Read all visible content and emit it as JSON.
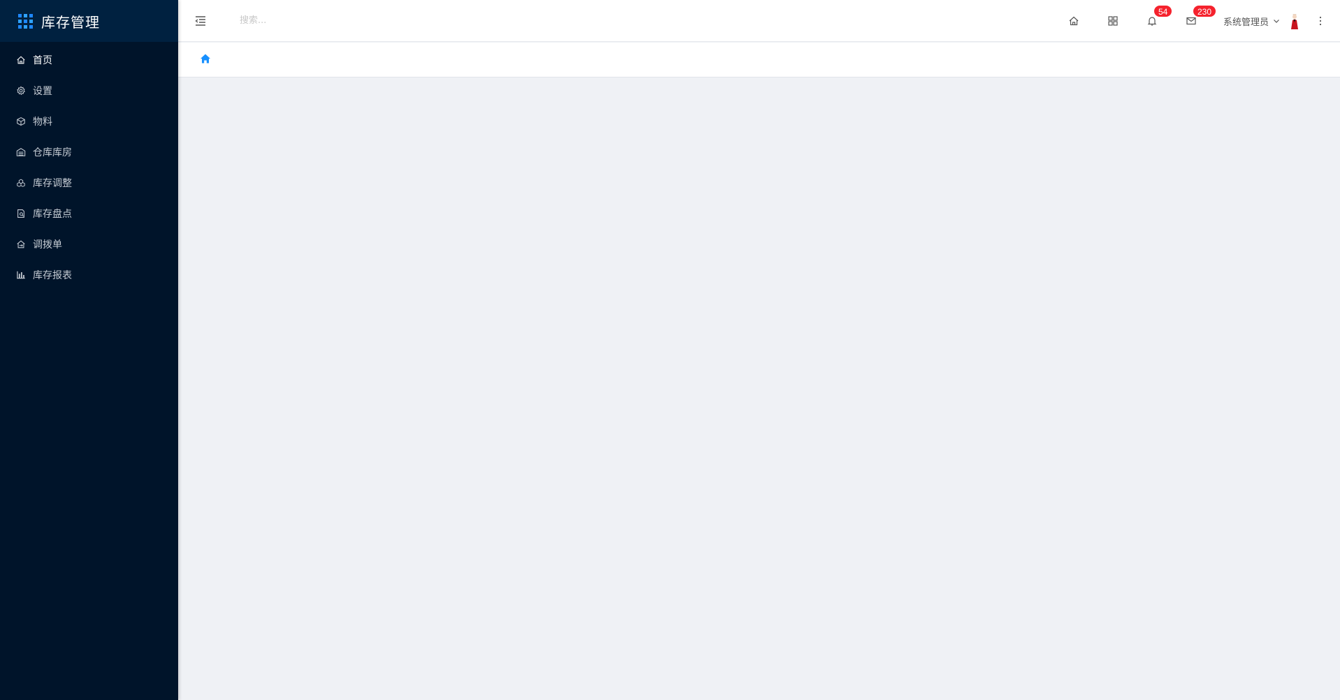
{
  "app": {
    "title": "库存管理"
  },
  "sidebar": {
    "items": [
      {
        "label": "首页",
        "icon": "home-icon",
        "active": true
      },
      {
        "label": "设置",
        "icon": "gear-icon",
        "active": false
      },
      {
        "label": "物料",
        "icon": "box-icon",
        "active": false
      },
      {
        "label": "仓库库房",
        "icon": "warehouse-icon",
        "active": false
      },
      {
        "label": "库存调整",
        "icon": "cubes-icon",
        "active": false
      },
      {
        "label": "库存盘点",
        "icon": "inventory-check-icon",
        "active": false
      },
      {
        "label": "调拨单",
        "icon": "transfer-icon",
        "active": false
      },
      {
        "label": "库存报表",
        "icon": "bar-chart-icon",
        "active": false
      }
    ]
  },
  "header": {
    "search_placeholder": "搜索...",
    "notifications_count": "54",
    "messages_count": "230",
    "user_name": "系统管理员"
  },
  "colors": {
    "sidebar_bg": "#00142a",
    "brand_bg": "#002140",
    "accent": "#1890ff",
    "badge": "#f5222d",
    "content_bg": "#eff1f5"
  }
}
